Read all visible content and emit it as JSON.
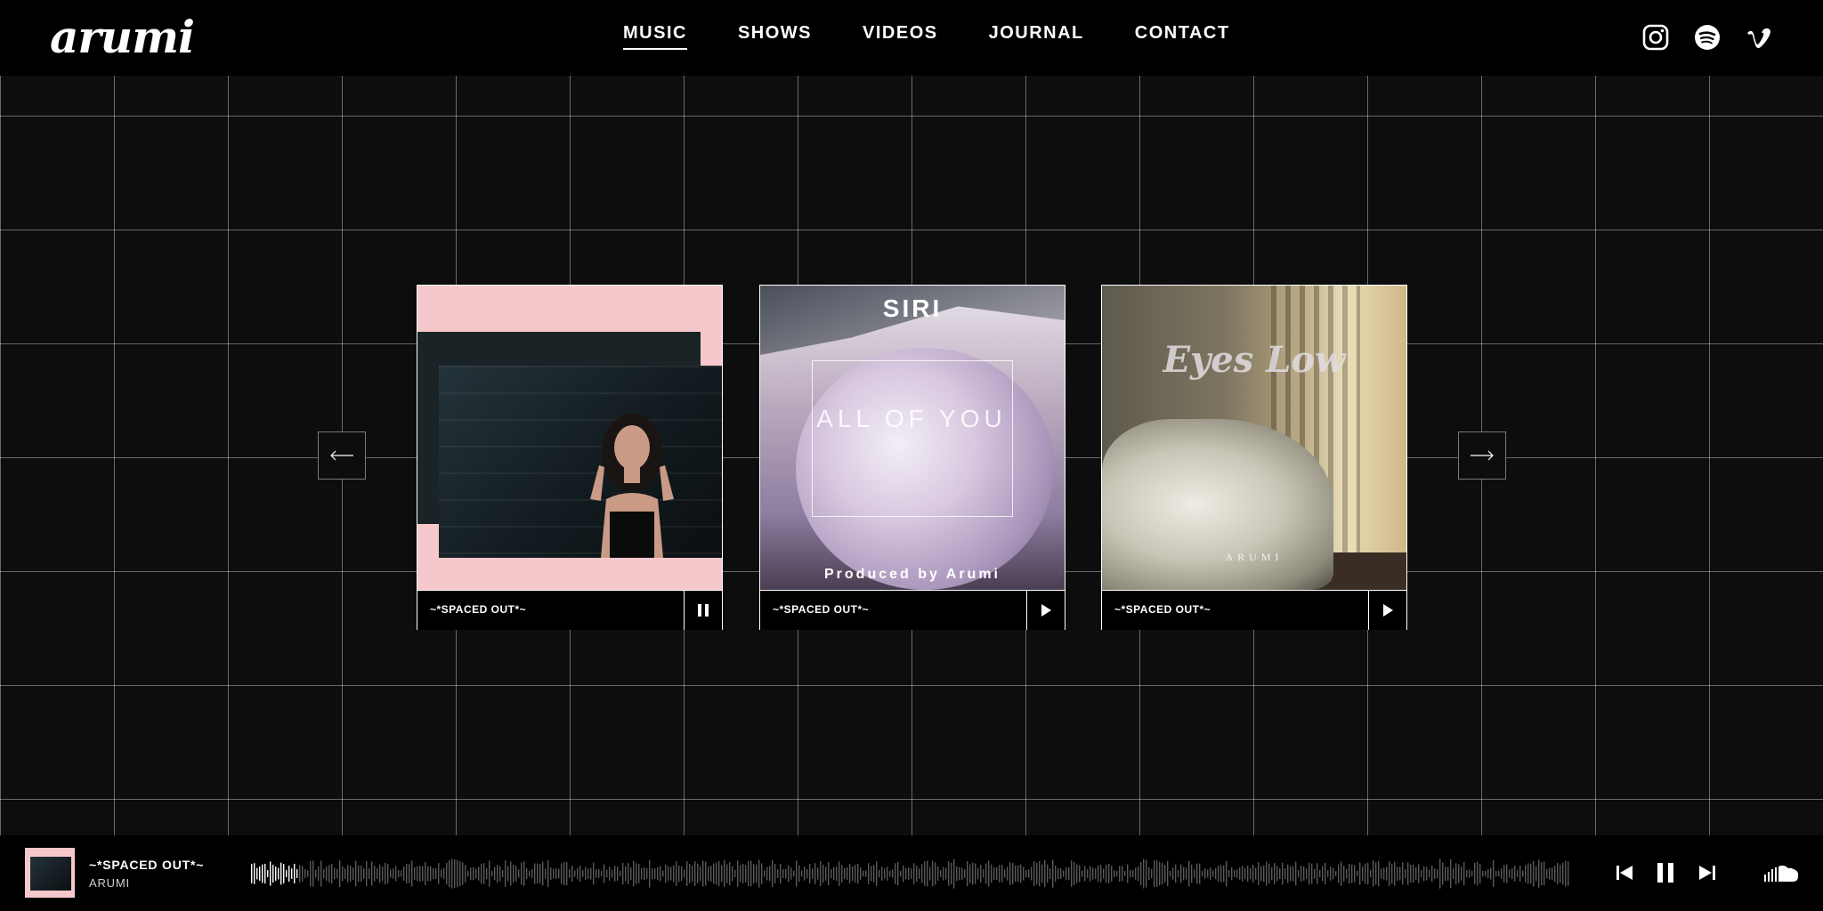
{
  "brand": {
    "logo": "arumi"
  },
  "nav": [
    {
      "label": "MUSIC",
      "active": true
    },
    {
      "label": "SHOWS",
      "active": false
    },
    {
      "label": "VIDEOS",
      "active": false
    },
    {
      "label": "JOURNAL",
      "active": false
    },
    {
      "label": "CONTACT",
      "active": false
    }
  ],
  "social": [
    "instagram-icon",
    "spotify-icon",
    "vimeo-icon"
  ],
  "carousel": {
    "cards": [
      {
        "title": "~*SPACED OUT*~",
        "state": "pause-icon"
      },
      {
        "title": "~*SPACED OUT*~",
        "state": "play-icon",
        "cover_text": {
          "top": "SIRI",
          "middle": "ALL OF YOU",
          "bottom": "Produced by Arumi"
        }
      },
      {
        "title": "~*SPACED OUT*~",
        "state": "play-icon",
        "cover_text": {
          "title": "Eyes Low",
          "artist": "ARUMI"
        }
      }
    ]
  },
  "player": {
    "track": "~*SPACED OUT*~",
    "artist": "ARUMI",
    "progress": 0.037
  },
  "colors": {
    "background": "#0d0d0d",
    "bar": "#000000",
    "accent_pink": "#f6c8cc"
  }
}
